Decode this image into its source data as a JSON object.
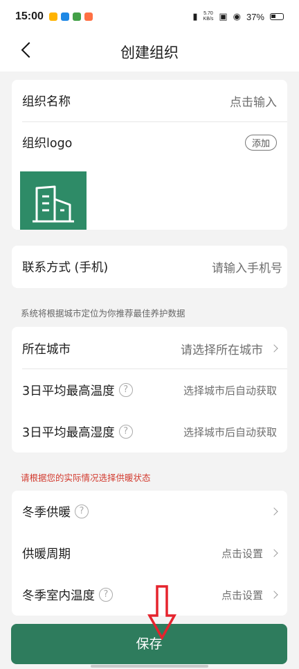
{
  "status_bar": {
    "time": "15:00",
    "net_speed_top": "5.70",
    "net_speed_unit": "KB/s",
    "battery": "37%"
  },
  "header": {
    "title": "创建组织"
  },
  "org": {
    "name_label": "组织名称",
    "name_placeholder": "点击输入",
    "logo_label": "组织logo",
    "add_label": "添加"
  },
  "contact": {
    "label": "联系方式 (手机)",
    "placeholder": "请输入手机号"
  },
  "city_tip": "系统将根据城市定位为你推荐最佳养护数据",
  "city": {
    "city_label": "所在城市",
    "city_value": "请选择所在城市",
    "temp_label": "3日平均最高温度",
    "temp_value": "选择城市后自动获取",
    "humidity_label": "3日平均最高湿度",
    "humidity_value": "选择城市后自动获取"
  },
  "heating_tip": "请根据您的实际情况选择供暖状态",
  "heating": {
    "winter_label": "冬季供暖",
    "period_label": "供暖周期",
    "period_value": "点击设置",
    "indoor_label": "冬季室内温度",
    "indoor_value": "点击设置"
  },
  "save_label": "保存",
  "colors": {
    "accent": "#2e7c5d",
    "logo_bg": "#2e8b67",
    "warning_text": "#d23a2e",
    "annotation_arrow": "#e5232d"
  }
}
